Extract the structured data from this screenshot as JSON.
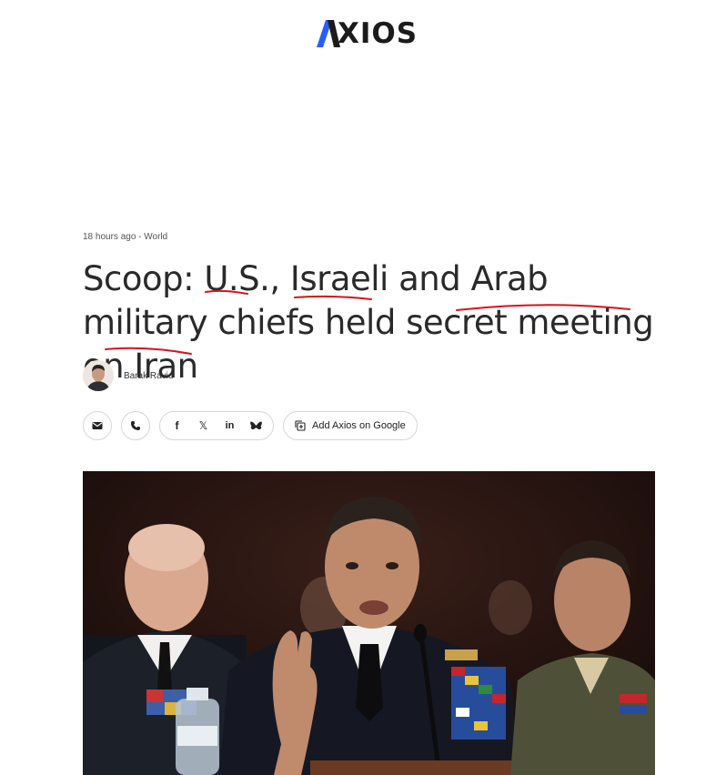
{
  "site": {
    "logo_text": "XIOS",
    "logo_alt": "AXIOS"
  },
  "article": {
    "time": "18 hours ago",
    "separator": " - ",
    "section": "World",
    "headline": "Scoop: U.S., Israeli and Arab military chiefs held secret meeting on Iran",
    "author": "Barak Ravid"
  },
  "share": {
    "email_icon": "email-icon",
    "phone_icon": "phone-icon",
    "facebook_label": "f",
    "x_label": "𝕏",
    "linkedin_label": "in",
    "bluesky_icon": "bluesky-icon",
    "google_label": "Add Axios on Google"
  },
  "colors": {
    "accent_blue": "#2a5dff",
    "annotation_red": "#d6141b",
    "text": "#2a2a2a"
  }
}
